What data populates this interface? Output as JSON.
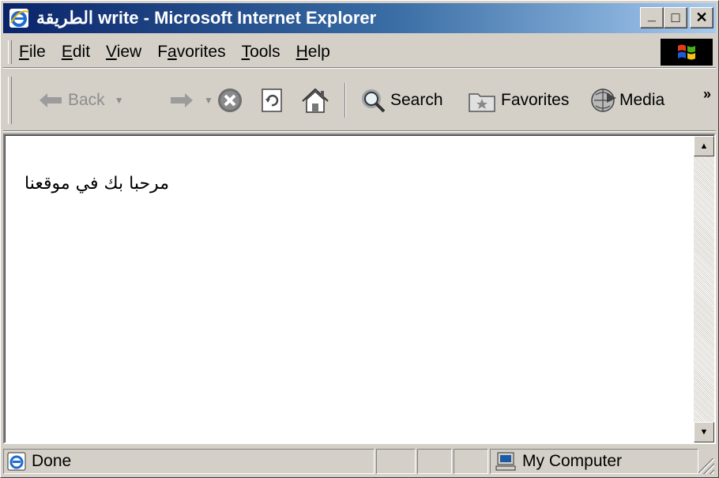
{
  "window": {
    "title": "الطريقة write - Microsoft Internet Explorer",
    "minimize_label": "_",
    "maximize_label": "□",
    "close_label": "✕"
  },
  "menu": {
    "items": [
      {
        "label": "File",
        "key": "F",
        "rest": "ile"
      },
      {
        "label": "Edit",
        "key": "E",
        "rest": "dit"
      },
      {
        "label": "View",
        "key": "V",
        "rest": "iew"
      },
      {
        "label": "Favorites",
        "pre": "F",
        "key": "a",
        "rest": "vorites"
      },
      {
        "label": "Tools",
        "key": "T",
        "rest": "ools"
      },
      {
        "label": "Help",
        "key": "H",
        "rest": "elp"
      }
    ]
  },
  "toolbar": {
    "back_label": "Back",
    "search_label": "Search",
    "favorites_label": "Favorites",
    "media_label": "Media",
    "more_label": "»"
  },
  "page": {
    "text": "مرحبا بك في موقعنا"
  },
  "status": {
    "text": "Done",
    "zone_label": "My Computer"
  }
}
